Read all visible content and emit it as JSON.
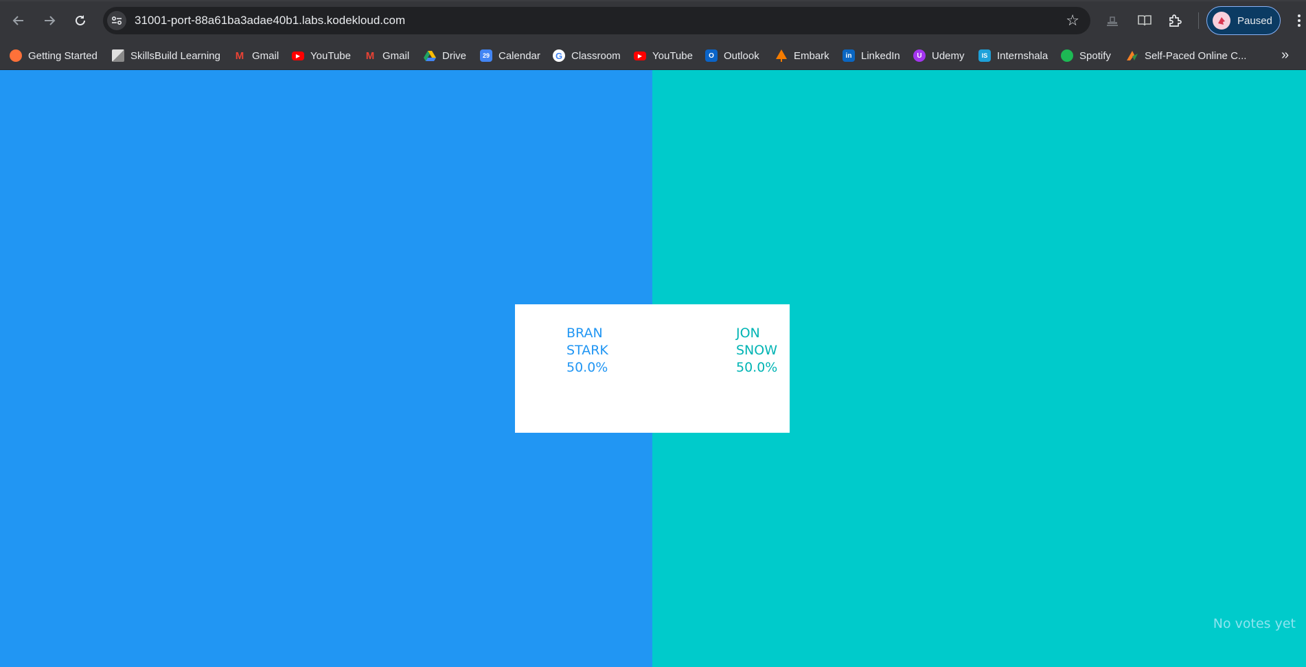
{
  "browser": {
    "url": "31001-port-88a61ba3adae40b1.labs.kodekloud.com",
    "profile_label": "Paused",
    "bookmarks": [
      {
        "label": "Getting Started",
        "icon": "firefox-icon",
        "color": "#ff7139"
      },
      {
        "label": "SkillsBuild Learning",
        "icon": "skillsbuild-icon",
        "color": "#9e9e9e"
      },
      {
        "label": "Gmail",
        "icon": "gmail-icon",
        "color": "#ea4335"
      },
      {
        "label": "YouTube",
        "icon": "youtube-icon",
        "color": "#ff0000"
      },
      {
        "label": "Gmail",
        "icon": "gmail-icon",
        "color": "#ea4335"
      },
      {
        "label": "Drive",
        "icon": "drive-icon",
        "color": "#1fa463"
      },
      {
        "label": "Calendar",
        "icon": "calendar-icon",
        "color": "#4285f4"
      },
      {
        "label": "Classroom",
        "icon": "google-icon",
        "color": "#ffffff"
      },
      {
        "label": "YouTube",
        "icon": "youtube-icon",
        "color": "#ff0000"
      },
      {
        "label": "Outlook",
        "icon": "outlook-icon",
        "color": "#0a64c8"
      },
      {
        "label": "Embark",
        "icon": "embark-icon",
        "color": "#f57c00"
      },
      {
        "label": "LinkedIn",
        "icon": "linkedin-icon",
        "color": "#0a66c2"
      },
      {
        "label": "Udemy",
        "icon": "udemy-icon",
        "color": "#a435f0"
      },
      {
        "label": "Internshala",
        "icon": "internshala-icon",
        "color": "#1ea1d9"
      },
      {
        "label": "Spotify",
        "icon": "spotify-icon",
        "color": "#1db954"
      },
      {
        "label": "Self-Paced Online C...",
        "icon": "gfg-icon",
        "color": "#f48024"
      }
    ]
  },
  "poll": {
    "option_a": {
      "name_line1": "BRAN",
      "name_line2": "STARK",
      "percent": "50.0%",
      "color": "#2196f3"
    },
    "option_b": {
      "name_line1": "JON",
      "name_line2": "SNOW",
      "percent": "50.0%",
      "color": "#00cbcb"
    },
    "status": "No votes yet"
  }
}
